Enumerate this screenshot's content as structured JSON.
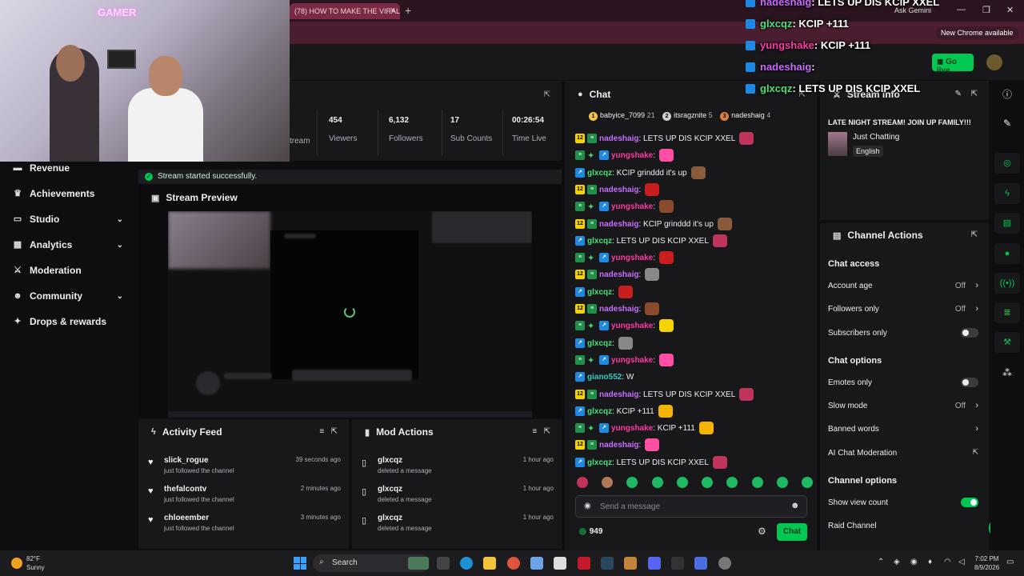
{
  "browser": {
    "tab_title": "(78) HOW TO MAKE THE VIRAL",
    "ask_gemini": "Ask Gemini",
    "new_chrome": "New Chrome available"
  },
  "header": {
    "go_live": "Go live"
  },
  "webcam": {
    "neon_sign": "GAMER"
  },
  "sidebar": {
    "items": [
      {
        "label": "Revenue",
        "icon": "dollar-icon"
      },
      {
        "label": "Achievements",
        "icon": "trophy-icon"
      },
      {
        "label": "Studio",
        "icon": "studio-icon"
      },
      {
        "label": "Analytics",
        "icon": "chart-icon"
      },
      {
        "label": "Moderation",
        "icon": "sword-icon"
      },
      {
        "label": "Community",
        "icon": "people-icon"
      },
      {
        "label": "Drops & rewards",
        "icon": "gift-icon"
      }
    ]
  },
  "stats": {
    "partial_label": "tream",
    "items": [
      {
        "value": "454",
        "label": "Viewers"
      },
      {
        "value": "6,132",
        "label": "Followers"
      },
      {
        "value": "17",
        "label": "Sub Counts"
      },
      {
        "value": "00:26:54",
        "label": "Time Live"
      }
    ]
  },
  "toast": {
    "text": "Stream started successfully."
  },
  "preview": {
    "title": "Stream Preview"
  },
  "activity": {
    "title": "Activity Feed",
    "items": [
      {
        "name": "slick_rogue",
        "sub": "just followed the channel",
        "time": "39 seconds ago"
      },
      {
        "name": "thefalcontv",
        "sub": "just followed the channel",
        "time": "2 minutes ago"
      },
      {
        "name": "chloeember",
        "sub": "just followed the channel",
        "time": "3 minutes ago"
      }
    ]
  },
  "mod": {
    "title": "Mod Actions",
    "items": [
      {
        "name": "glxcqz",
        "sub": "deleted a message",
        "time": "1 hour ago"
      },
      {
        "name": "glxcqz",
        "sub": "deleted a message",
        "time": "1 hour ago"
      },
      {
        "name": "glxcqz",
        "sub": "deleted a message",
        "time": "1 hour ago"
      }
    ]
  },
  "chat": {
    "title": "Chat",
    "leaders": [
      {
        "rank": "1",
        "name": "babyice_7099",
        "count": "21",
        "color": "#f5c542"
      },
      {
        "rank": "2",
        "name": "itsragznite",
        "count": "5",
        "color": "#d0d0d0"
      },
      {
        "rank": "3",
        "name": "nadeshaig",
        "count": "4",
        "color": "#d9823b"
      }
    ],
    "messages": [
      {
        "badges": [
          "12",
          "green"
        ],
        "user": "nadeshaig",
        "cls": "u-pink",
        "text": ": LETS UP DIS KCIP XXEL",
        "emote": "#c0335a"
      },
      {
        "badges": [
          "green",
          "star",
          "blue"
        ],
        "user": "yungshake",
        "cls": "u-red",
        "text": ":",
        "emote": "#ff4fa3"
      },
      {
        "badges": [
          "blue"
        ],
        "user": "glxcqz",
        "cls": "u-green",
        "text": ": KCIP grinddd it's up",
        "emote": "#8a5a3c"
      },
      {
        "badges": [
          "12",
          "green"
        ],
        "user": "nadeshaig",
        "cls": "u-pink",
        "text": ":",
        "emote": "#c81e1e"
      },
      {
        "badges": [
          "green",
          "star",
          "blue"
        ],
        "user": "yungshake",
        "cls": "u-red",
        "text": ":",
        "emote": "#8a4a2c"
      },
      {
        "badges": [
          "12",
          "green"
        ],
        "user": "nadeshaig",
        "cls": "u-pink",
        "text": ": KCIP grinddd it's up",
        "emote": "#8a5a3c"
      },
      {
        "badges": [
          "blue"
        ],
        "user": "glxcqz",
        "cls": "u-green",
        "text": ": LETS UP DIS KCIP XXEL",
        "emote": "#c0335a"
      },
      {
        "badges": [
          "green",
          "star",
          "blue"
        ],
        "user": "yungshake",
        "cls": "u-red",
        "text": ":",
        "emote": "#c81e1e"
      },
      {
        "badges": [
          "12",
          "green"
        ],
        "user": "nadeshaig",
        "cls": "u-pink",
        "text": ":",
        "emote": "#888888"
      },
      {
        "badges": [
          "blue"
        ],
        "user": "glxcqz",
        "cls": "u-green",
        "text": ":",
        "emote": "#c81e1e"
      },
      {
        "badges": [
          "12",
          "green"
        ],
        "user": "nadeshaig",
        "cls": "u-pink",
        "text": ":",
        "emote": "#8a4a2c"
      },
      {
        "badges": [
          "green",
          "star",
          "blue"
        ],
        "user": "yungshake",
        "cls": "u-red",
        "text": ":",
        "emote": "#f5d300"
      },
      {
        "badges": [
          "blue"
        ],
        "user": "glxcqz",
        "cls": "u-green",
        "text": ":",
        "emote": "#888888"
      },
      {
        "badges": [
          "green",
          "star",
          "blue"
        ],
        "user": "yungshake",
        "cls": "u-red",
        "text": ":",
        "emote": "#ff4fa3"
      },
      {
        "badges": [
          "blue"
        ],
        "user": "giano552",
        "cls": "u-teal",
        "text": ": W",
        "emote": ""
      },
      {
        "badges": [
          "12",
          "green"
        ],
        "user": "nadeshaig",
        "cls": "u-pink",
        "text": ": LETS UP DIS KCIP XXEL",
        "emote": "#c0335a"
      },
      {
        "badges": [
          "blue"
        ],
        "user": "glxcqz",
        "cls": "u-green",
        "text": ": KCIP +111",
        "emote": "#f5b400"
      },
      {
        "badges": [
          "green",
          "star",
          "blue"
        ],
        "user": "yungshake",
        "cls": "u-red",
        "text": ": KCIP +111",
        "emote": "#f5b400"
      },
      {
        "badges": [
          "12",
          "green"
        ],
        "user": "nadeshaig",
        "cls": "u-pink",
        "text": ":",
        "emote": "#ff4fa3"
      },
      {
        "badges": [
          "blue"
        ],
        "user": "glxcqz",
        "cls": "u-green",
        "text": ": LETS UP DIS KCIP XXEL",
        "emote": "#c0335a"
      }
    ],
    "input_placeholder": "Send a message",
    "points": "949",
    "send": "Chat"
  },
  "overlay": [
    {
      "user": "nadeshaig",
      "text": ": LETS UP DIS KCIP XXEL",
      "color": "#c86bff"
    },
    {
      "user": "glxcqz",
      "text": ": KCIP +111",
      "color": "#49e07a"
    },
    {
      "user": "yungshake",
      "text": ": KCIP +111",
      "color": "#ff3aa6"
    },
    {
      "user": "nadeshaig",
      "text": ":",
      "color": "#c86bff"
    },
    {
      "user": "glxcqz",
      "text": ": LETS UP DIS KCIP XXEL",
      "color": "#49e07a"
    }
  ],
  "stream_info": {
    "title": "Stream info",
    "stream_title": "LATE NIGHT STREAM! JOIN UP FAMILY!!!",
    "category": "Just Chatting",
    "language": "English"
  },
  "channel_actions": {
    "title": "Channel Actions",
    "chat_access": "Chat access",
    "account_age": {
      "label": "Account age",
      "value": "Off"
    },
    "followers_only": {
      "label": "Followers only",
      "value": "Off"
    },
    "subscribers_only": {
      "label": "Subscribers only",
      "on": false
    },
    "chat_options": "Chat options",
    "emotes_only": {
      "label": "Emotes only",
      "on": false
    },
    "slow_mode": {
      "label": "Slow mode",
      "value": "Off"
    },
    "banned_words": "Banned words",
    "ai_moderation": "AI Chat Moderation",
    "channel_options": "Channel options",
    "show_view_count": {
      "label": "Show view count",
      "on": true
    },
    "raid_channel": "Raid Channel"
  },
  "taskbar": {
    "temp": "82°F",
    "weather": "Sunny",
    "search": "Search",
    "time": "7:02 PM",
    "date": "8/9/2026"
  }
}
